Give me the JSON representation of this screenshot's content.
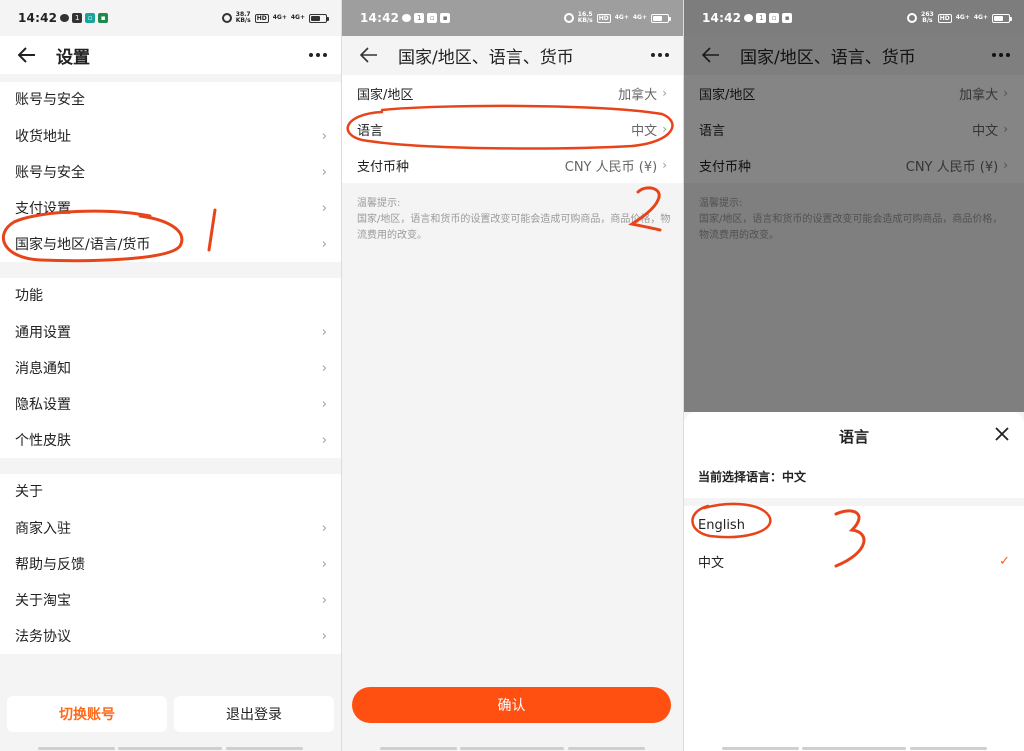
{
  "status": {
    "p1": {
      "time": "14:42",
      "speed_top": "38.7",
      "speed_unit": "KB/s",
      "hd": "HD",
      "sig1": "4G+",
      "sig2": "4G+"
    },
    "p2": {
      "time": "14:42",
      "speed_top": "16.5",
      "speed_unit": "KB/s",
      "hd": "HD",
      "sig1": "4G+",
      "sig2": "4G+"
    },
    "p3": {
      "time": "14:42",
      "speed_top": "263",
      "speed_unit": "B/s",
      "hd": "HD",
      "sig1": "4G+",
      "sig2": "4G+"
    }
  },
  "screen1": {
    "title": "设置",
    "groups": [
      {
        "title": "账号与安全",
        "items": [
          "收货地址",
          "账号与安全",
          "支付设置",
          "国家与地区/语言/货币"
        ]
      },
      {
        "title": "功能",
        "items": [
          "通用设置",
          "消息通知",
          "隐私设置",
          "个性皮肤"
        ]
      },
      {
        "title": "关于",
        "items": [
          "商家入驻",
          "帮助与反馈",
          "关于淘宝",
          "法务协议"
        ]
      }
    ],
    "switch_account": "切换账号",
    "logout": "退出登录",
    "annotation": "1"
  },
  "screen2": {
    "title": "国家/地区、语言、货币",
    "rows": [
      {
        "label": "国家/地区",
        "value": "加拿大"
      },
      {
        "label": "语言",
        "value": "中文"
      },
      {
        "label": "支付币种",
        "value": "CNY 人民币 (¥)"
      }
    ],
    "tip_title": "温馨提示:",
    "tip_text": "国家/地区，语言和货币的设置改变可能会造成可购商品，商品价格，物流费用的改变。",
    "confirm": "确认",
    "annotation": "2"
  },
  "screen3": {
    "title": "国家/地区、语言、货币",
    "rows": [
      {
        "label": "国家/地区",
        "value": "加拿大"
      },
      {
        "label": "语言",
        "value": "中文"
      },
      {
        "label": "支付币种",
        "value": "CNY 人民币 (¥)"
      }
    ],
    "tip_title": "温馨提示:",
    "tip_text": "国家/地区，语言和货币的设置改变可能会造成可购商品，商品价格，物流费用的改变。",
    "sheet_title": "语言",
    "current_language": "当前选择语言：中文",
    "options": [
      "English",
      "中文"
    ],
    "selected_option": "中文",
    "annotation": "3"
  },
  "colors": {
    "accent": "#ff5011",
    "switch_text": "#ff6a1a",
    "annotation": "#e8441a"
  },
  "icons": {
    "back": "arrow-left-icon",
    "more": "more-dots-icon",
    "chevron": "chevron-right-icon",
    "close": "close-icon",
    "check": "check-icon"
  }
}
